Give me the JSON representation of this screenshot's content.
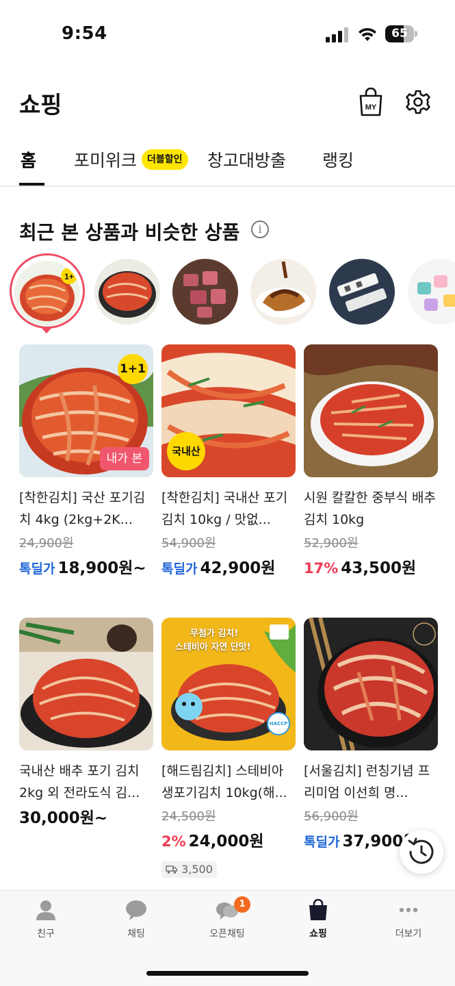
{
  "status_bar": {
    "time": "9:54",
    "battery": "65",
    "battery_level": 0.65
  },
  "header": {
    "title": "쇼핑",
    "my_label": "MY"
  },
  "tabs": [
    {
      "label": "홈",
      "active": true
    },
    {
      "label": "포미위크",
      "badge": "더블할인"
    },
    {
      "label": "창고대방출"
    },
    {
      "label": "랭킹"
    }
  ],
  "section": {
    "title": "최근 본 상품과 비슷한 상품",
    "info": "i"
  },
  "recent_items": [
    {
      "name": "kimchi-1plus1",
      "badge": "1+",
      "selected": true
    },
    {
      "name": "kimchi-bowl"
    },
    {
      "name": "meat-cubes"
    },
    {
      "name": "pork-cutlet"
    },
    {
      "name": "multi-plug"
    },
    {
      "name": "toy-locks"
    }
  ],
  "products": [
    {
      "name": "[착한김치] 국산 포기김치 4kg (2kg+2K...",
      "original_price": "24,900원",
      "price_label": "톡딜가",
      "price": "18,900원~",
      "badge_top": "1+1",
      "badge_bottom": "내가 본"
    },
    {
      "name": "[착한김치] 국내산 포기김치 10kg / 맛없...",
      "original_price": "54,900원",
      "price_label": "톡딜가",
      "price": "42,900원",
      "badge_corner": "국내산"
    },
    {
      "name": "시원 칼칼한 중부식 배추김치 10kg",
      "original_price": "52,900원",
      "discount": "17%",
      "price": "43,500원"
    },
    {
      "name": "국내산 배추 포기 김치 2kg 외 전라도식 김...",
      "price": "30,000원~"
    },
    {
      "name": "[해드림김치] 스테비아 생포기김치 10kg(해...",
      "original_price": "24,500원",
      "discount": "2%",
      "price": "24,000원",
      "shipping": "3,500",
      "overlay_line1": "무첨가 김치!",
      "overlay_line2": "스테비아 자연 단맛!",
      "haccp": "HACCP"
    },
    {
      "name": "[서울김치] 런칭기념 프리미엄 이선희 명...",
      "original_price": "56,900원",
      "price_label": "톡딜가",
      "price": "37,900원"
    }
  ],
  "bottom_nav": [
    {
      "label": "친구",
      "icon": "person-icon"
    },
    {
      "label": "채팅",
      "icon": "chat-bubble-icon"
    },
    {
      "label": "오픈채팅",
      "icon": "open-chat-icon",
      "badge": "1"
    },
    {
      "label": "쇼핑",
      "icon": "shopping-bag-icon",
      "active": true
    },
    {
      "label": "더보기",
      "icon": "more-dots-icon"
    }
  ],
  "colors": {
    "deal_blue": "#1e64d6",
    "discount_red": "#ef3d55",
    "badge_yellow": "#ffd800",
    "selection_pink": "#ef4c63",
    "notify_orange": "#f26b21"
  }
}
